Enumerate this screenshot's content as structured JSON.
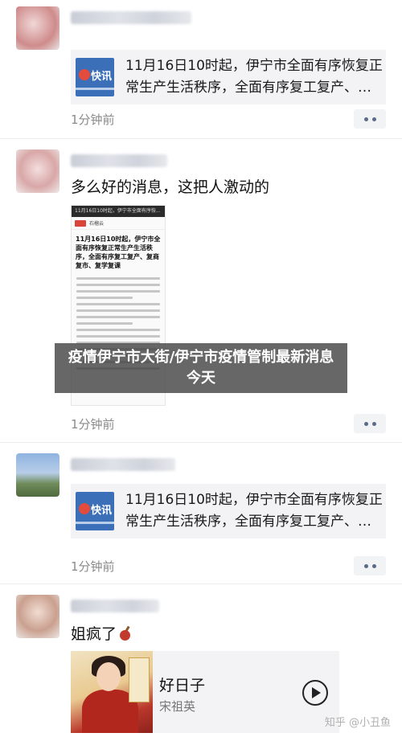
{
  "posts": [
    {
      "link_card": {
        "thumb_label": "快讯",
        "text": "11月16日10时起，伊宁市全面有序恢复正常生产生活秩序，全面有序复工复产、…"
      },
      "time": "1分钟前"
    },
    {
      "text": "多么好的消息，这把人激动的",
      "image_doc": {
        "top_bar": "11月16日10时起，伊宁市全面有序恢...",
        "source": "石榴云",
        "headline": "11月16日10时起，伊宁市全面有序恢复正常生产生活秩序，全面有序复工复产、复商复市、复学复课"
      },
      "time": "1分钟前"
    },
    {
      "link_card": {
        "thumb_label": "快讯",
        "text": "11月16日10时起，伊宁市全面有序恢复正常生产生活秩序，全面有序复工复产、…"
      },
      "time": "1分钟前"
    },
    {
      "text": "姐疯了",
      "music_card": {
        "title": "好日子",
        "artist": "宋祖英"
      }
    }
  ],
  "banner": "疫情伊宁市大街/伊宁市疫情管制最新消息今天",
  "watermark": "知乎 @小丑鱼",
  "colors": {
    "card_bg": "#f3f3f5",
    "time_text": "#8a8a8a",
    "banner_bg": "#3c3c3c"
  },
  "icons": [
    "more-dots-icon",
    "play-icon",
    "bomb-emoji-icon"
  ]
}
